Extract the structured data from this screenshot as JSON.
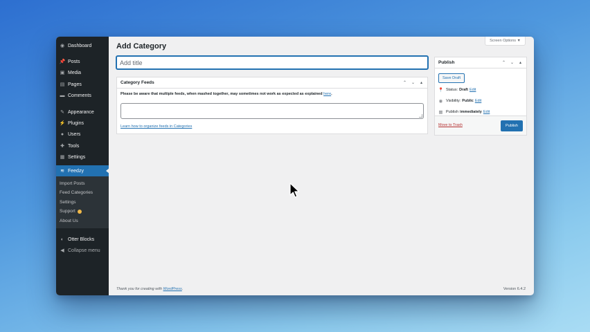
{
  "sidebar": {
    "groups": [
      [
        {
          "label": "Dashboard",
          "icon": "dashboard-icon",
          "glyph": "◉"
        }
      ],
      [
        {
          "label": "Posts",
          "icon": "pin-icon",
          "glyph": "📌"
        },
        {
          "label": "Media",
          "icon": "media-icon",
          "glyph": "▣"
        },
        {
          "label": "Pages",
          "icon": "page-icon",
          "glyph": "▤"
        },
        {
          "label": "Comments",
          "icon": "comment-icon",
          "glyph": "▬"
        }
      ],
      [
        {
          "label": "Appearance",
          "icon": "brush-icon",
          "glyph": "✎"
        },
        {
          "label": "Plugins",
          "icon": "plug-icon",
          "glyph": "⚡"
        },
        {
          "label": "Users",
          "icon": "user-icon",
          "glyph": "●"
        },
        {
          "label": "Tools",
          "icon": "wrench-icon",
          "glyph": "✚"
        },
        {
          "label": "Settings",
          "icon": "settings-icon",
          "glyph": "▦"
        }
      ]
    ],
    "active": {
      "label": "Feedzy",
      "icon": "feedzy-icon",
      "glyph": "≋"
    },
    "submenu": [
      "Import Posts",
      "Feed Categories",
      "Settings",
      "Support",
      "About Us"
    ],
    "bottom": [
      {
        "label": "Otter Blocks",
        "icon": "otter-icon",
        "glyph": "◐"
      },
      {
        "label": "Collapse menu",
        "icon": "collapse-icon",
        "glyph": "◀"
      }
    ]
  },
  "screen_options": "Screen Options ▼",
  "page_title": "Add Category",
  "title_placeholder": "Add title",
  "category_feeds": {
    "title": "Category Feeds",
    "notice": "Please be aware that multiple feeds, when mashed together, may sometimes not work as expected as explained",
    "notice_link": "here",
    "notice_end": ".",
    "learn_link": "Learn how to organize feeds in Categories"
  },
  "publish_box": {
    "title": "Publish",
    "save_draft": "Save Draft",
    "status_label": "Status:",
    "status_value": "Draft",
    "visibility_label": "Visibility:",
    "visibility_value": "Public",
    "publish_label": "Publish",
    "publish_value": "immediately",
    "edit_label": "Edit",
    "trash": "Move to Trash",
    "publish_button": "Publish"
  },
  "footer": {
    "thanks": "Thank you for creating with",
    "wordpress": "WordPress",
    "thanks_end": ".",
    "version": "Version 6.4.2"
  }
}
